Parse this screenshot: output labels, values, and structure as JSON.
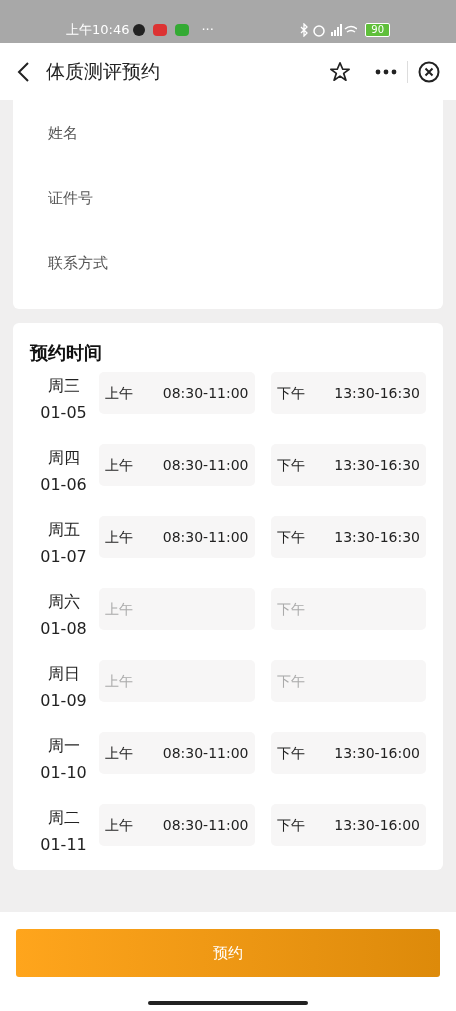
{
  "status_bar": {
    "time": "上午10:46",
    "more": "···",
    "battery": "90"
  },
  "header": {
    "title": "体质测评预约"
  },
  "form": {
    "fields": [
      {
        "placeholder": "姓名"
      },
      {
        "placeholder": "证件号"
      },
      {
        "placeholder": "联系方式"
      }
    ]
  },
  "schedule": {
    "title": "预约时间",
    "days": [
      {
        "weekday": "周三",
        "date": "01-05",
        "slots": [
          {
            "period": "上午",
            "time": "08:30-11:00",
            "disabled": false
          },
          {
            "period": "下午",
            "time": "13:30-16:30",
            "disabled": false
          }
        ]
      },
      {
        "weekday": "周四",
        "date": "01-06",
        "slots": [
          {
            "period": "上午",
            "time": "08:30-11:00",
            "disabled": false
          },
          {
            "period": "下午",
            "time": "13:30-16:30",
            "disabled": false
          }
        ]
      },
      {
        "weekday": "周五",
        "date": "01-07",
        "slots": [
          {
            "period": "上午",
            "time": "08:30-11:00",
            "disabled": false
          },
          {
            "period": "下午",
            "time": "13:30-16:30",
            "disabled": false
          }
        ]
      },
      {
        "weekday": "周六",
        "date": "01-08",
        "slots": [
          {
            "period": "上午",
            "disabled": true
          },
          {
            "period": "下午",
            "disabled": true
          }
        ]
      },
      {
        "weekday": "周日",
        "date": "01-09",
        "slots": [
          {
            "period": "上午",
            "disabled": true
          },
          {
            "period": "下午",
            "disabled": true
          }
        ]
      },
      {
        "weekday": "周一",
        "date": "01-10",
        "slots": [
          {
            "period": "上午",
            "time": "08:30-11:00",
            "disabled": false
          },
          {
            "period": "下午",
            "time": "13:30-16:00",
            "disabled": false
          }
        ]
      },
      {
        "weekday": "周二",
        "date": "01-11",
        "slots": [
          {
            "period": "上午",
            "time": "08:30-11:00",
            "disabled": false
          },
          {
            "period": "下午",
            "time": "13:30-16:00",
            "disabled": false
          }
        ]
      }
    ]
  },
  "submit": {
    "label": "预约"
  }
}
